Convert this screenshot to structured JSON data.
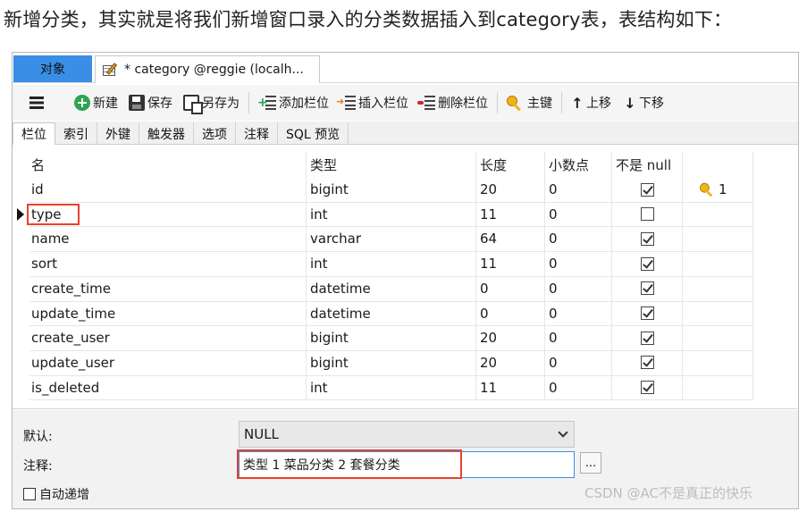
{
  "headline": "新增分类，其实就是将我们新增窗口录入的分类数据插入到category表，表结构如下：",
  "tabs": {
    "objects": "对象",
    "design": "* category @reggie (localh..."
  },
  "toolbar": {
    "new": "新建",
    "save": "保存",
    "save_as": "另存为",
    "add_column": "添加栏位",
    "insert_column": "插入栏位",
    "delete_column": "删除栏位",
    "primary_key": "主键",
    "move_up": "上移",
    "move_down": "下移"
  },
  "subtabs": [
    "栏位",
    "索引",
    "外键",
    "触发器",
    "选项",
    "注释",
    "SQL 预览"
  ],
  "columns_header": {
    "name": "名",
    "type": "类型",
    "length": "长度",
    "decimal": "小数点",
    "not_null": "不是 null"
  },
  "rows": [
    {
      "name": "id",
      "type": "bigint",
      "length": "20",
      "decimal": "0",
      "not_null": true,
      "key": "1"
    },
    {
      "name": "type",
      "type": "int",
      "length": "11",
      "decimal": "0",
      "not_null": false,
      "key": ""
    },
    {
      "name": "name",
      "type": "varchar",
      "length": "64",
      "decimal": "0",
      "not_null": true,
      "key": ""
    },
    {
      "name": "sort",
      "type": "int",
      "length": "11",
      "decimal": "0",
      "not_null": true,
      "key": ""
    },
    {
      "name": "create_time",
      "type": "datetime",
      "length": "0",
      "decimal": "0",
      "not_null": true,
      "key": ""
    },
    {
      "name": "update_time",
      "type": "datetime",
      "length": "0",
      "decimal": "0",
      "not_null": true,
      "key": ""
    },
    {
      "name": "create_user",
      "type": "bigint",
      "length": "20",
      "decimal": "0",
      "not_null": true,
      "key": ""
    },
    {
      "name": "update_user",
      "type": "bigint",
      "length": "20",
      "decimal": "0",
      "not_null": true,
      "key": ""
    },
    {
      "name": "is_deleted",
      "type": "int",
      "length": "11",
      "decimal": "0",
      "not_null": true,
      "key": ""
    }
  ],
  "selected_row": 1,
  "bottom": {
    "default_label": "默认:",
    "default_value": "NULL",
    "comment_label": "注释:",
    "comment_value": "类型   1 菜品分类 2 套餐分类",
    "dots": "...",
    "auto_increment": "自动递增"
  },
  "watermark": "CSDN @AC不是真正的快乐",
  "colors": {
    "accent_tab": "#3a8ee6",
    "highlight_box": "#e8412c",
    "key_icon": "#f2b21b"
  }
}
